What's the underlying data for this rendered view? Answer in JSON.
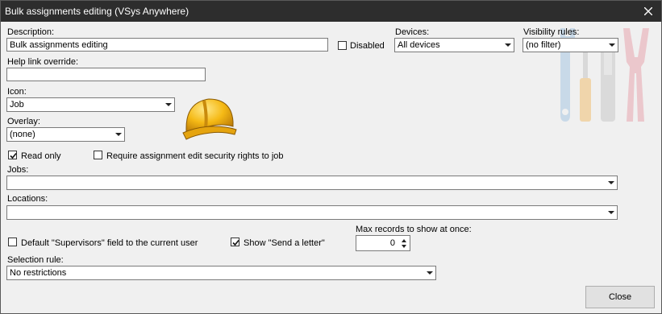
{
  "window": {
    "title": "Bulk assignments editing  (VSys Anywhere)",
    "close_icon": "close-icon"
  },
  "description": {
    "label": "Description:",
    "value": "Bulk assignments editing"
  },
  "disabled": {
    "label": "Disabled",
    "checked": false
  },
  "devices": {
    "label": "Devices:",
    "value": "All devices"
  },
  "visibility_rules": {
    "label": "Visibility rules:",
    "value": "(no filter)"
  },
  "help_link": {
    "label": "Help link override:",
    "value": ""
  },
  "icon": {
    "label": "Icon:",
    "value": "Job",
    "preview_icon": "hard-hat-icon"
  },
  "overlay": {
    "label": "Overlay:",
    "value": "(none)"
  },
  "read_only": {
    "label": "Read only",
    "checked": true
  },
  "require_security": {
    "label": "Require assignment edit security rights to job",
    "checked": false
  },
  "jobs": {
    "label": "Jobs:",
    "value": ""
  },
  "locations": {
    "label": "Locations:",
    "value": ""
  },
  "default_supervisors": {
    "label": "Default \"Supervisors\" field to the current user",
    "checked": false
  },
  "show_send_letter": {
    "label": "Show \"Send a letter\"",
    "checked": true
  },
  "max_records": {
    "label": "Max records to show at once:",
    "value": "0"
  },
  "selection_rule": {
    "label": "Selection rule:",
    "value": "No restrictions"
  },
  "close_button": {
    "label": "Close"
  },
  "decoration_icon": "tools-icon"
}
